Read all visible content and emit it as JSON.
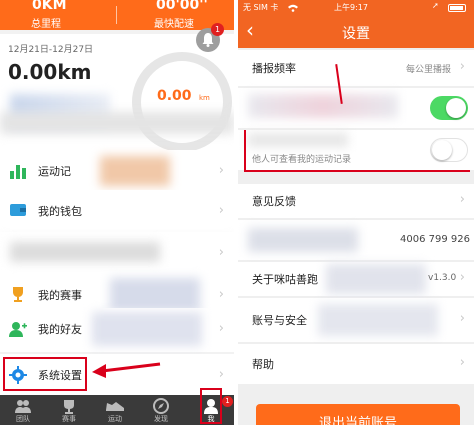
{
  "colors": {
    "accent_orange": "#ff6b1a",
    "header_orange": "#f26522",
    "toggle_green": "#4cd964",
    "annotation_red": "#d9001b",
    "sport_green": "#2fb65b",
    "wallet_blue": "#2d9cdb",
    "trophy_gold": "#f0a020",
    "settings_blue": "#1e88e5"
  },
  "left": {
    "stats": {
      "total_distance_value": "0KM",
      "total_distance_label": "总里程",
      "fastest_pace_value": "00'00''",
      "fastest_pace_label": "最快配速"
    },
    "notification_badge": "1",
    "week": {
      "range": "12月21日-12月27日",
      "distance": "0.00km",
      "ring_value": "0.00",
      "ring_unit": "km"
    },
    "menu": {
      "sport_record": "运动记",
      "wallet": "我的钱包",
      "my_events": "我的赛事",
      "my_friends": "我的好友",
      "system_settings": "系统设置"
    },
    "tabs": [
      {
        "label": "团队",
        "icon": "group-icon"
      },
      {
        "label": "赛事",
        "icon": "trophy-icon"
      },
      {
        "label": "运动",
        "icon": "shoe-icon"
      },
      {
        "label": "发现",
        "icon": "discover-icon"
      },
      {
        "label": "我",
        "icon": "person-icon"
      }
    ],
    "tab_badge": "1"
  },
  "right": {
    "status": {
      "carrier": "无 SIM 卡",
      "time": "上午9:17"
    },
    "title": "设置",
    "back_icon": "chevron-left-icon",
    "rows": {
      "broadcast_frequency_label": "播报频率",
      "broadcast_frequency_value": "每公里播报",
      "record_subtitle": "他人可查看我的运动记录",
      "feedback": "意见反馈",
      "phone": "4006 799 926",
      "about": "关于咪咕善跑",
      "version": "v1.3.0",
      "account_security": "账号与安全",
      "help": "帮助"
    },
    "logout": "退出当前账号"
  }
}
